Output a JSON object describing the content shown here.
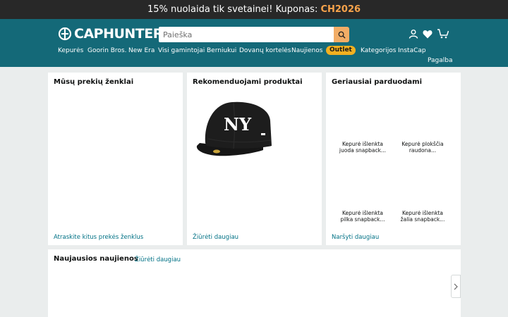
{
  "promo": {
    "text": "15% nuolaida tik svetainei!  Kuponas: ",
    "code": "CH2026"
  },
  "header": {
    "logo_text": "CAPHUNTERS",
    "search_placeholder": "Paieška",
    "icons": [
      "search-icon",
      "user-icon",
      "heart-icon",
      "cart-icon"
    ],
    "nav": [
      "Kepurės",
      "Goorin Bros.",
      "New Era",
      "Visi gamintojai",
      "Berniukui",
      "Dovanų kortelės",
      "Naujienos",
      "Outlet",
      "Kategorijos",
      "InstaCap"
    ],
    "help": "Pagalba"
  },
  "brands": {
    "title": "Mūsų prekių ženklai",
    "link": "Atraskite kitus prekės ženklus"
  },
  "recommended": {
    "title": "Rekomenduojami produktai",
    "link": "Žiūrėti daugiau"
  },
  "bestsellers": {
    "title": "Geriausiai parduodami",
    "items": [
      {
        "line1": "Kepurė išlenkta",
        "line2": "juoda snapback..."
      },
      {
        "line1": "Kepurė plokščia",
        "line2": "raudona..."
      },
      {
        "line1": "Kepurė išlenkta",
        "line2": "pilka snapback..."
      },
      {
        "line1": "Kepurė išlenkta",
        "line2": "žalia snapback..."
      }
    ],
    "link": "Naršyti daugiau"
  },
  "news": {
    "title": "Naujausios naujienos",
    "link": "Žiūrėti daugiau"
  },
  "colors": {
    "promo_bg": "#282828",
    "header_bg": "#146978",
    "accent": "#f7a34b",
    "outlet": "#f2b020",
    "link": "#007185",
    "page_bg": "#eaeded"
  }
}
